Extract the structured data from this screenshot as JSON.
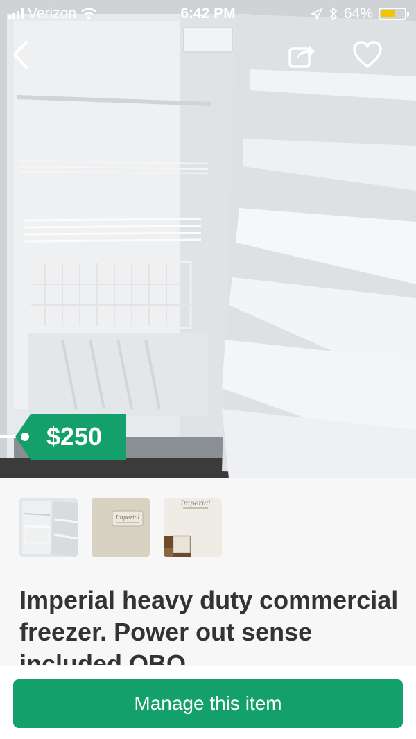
{
  "status_bar": {
    "carrier": "Verizon",
    "time": "6:42 PM",
    "battery": "64%",
    "battery_level": 0.64,
    "battery_color": "#f5c400"
  },
  "nav": {
    "back_icon": "chevron-left-icon",
    "share_icon": "share-icon",
    "favorite_icon": "heart-icon"
  },
  "listing": {
    "price": "$250",
    "title": "Imperial heavy duty commercial freezer. Power out sense included OBO",
    "thumbnails": [
      {
        "id": "thumb-open-freezer",
        "label": ""
      },
      {
        "id": "thumb-brand-badge",
        "label": "Imperial"
      },
      {
        "id": "thumb-detail",
        "label": "Imperial"
      }
    ]
  },
  "actions": {
    "manage_label": "Manage this item"
  },
  "colors": {
    "accent": "#14a06a",
    "title_text": "#333333",
    "background": "#f7f7f7"
  }
}
